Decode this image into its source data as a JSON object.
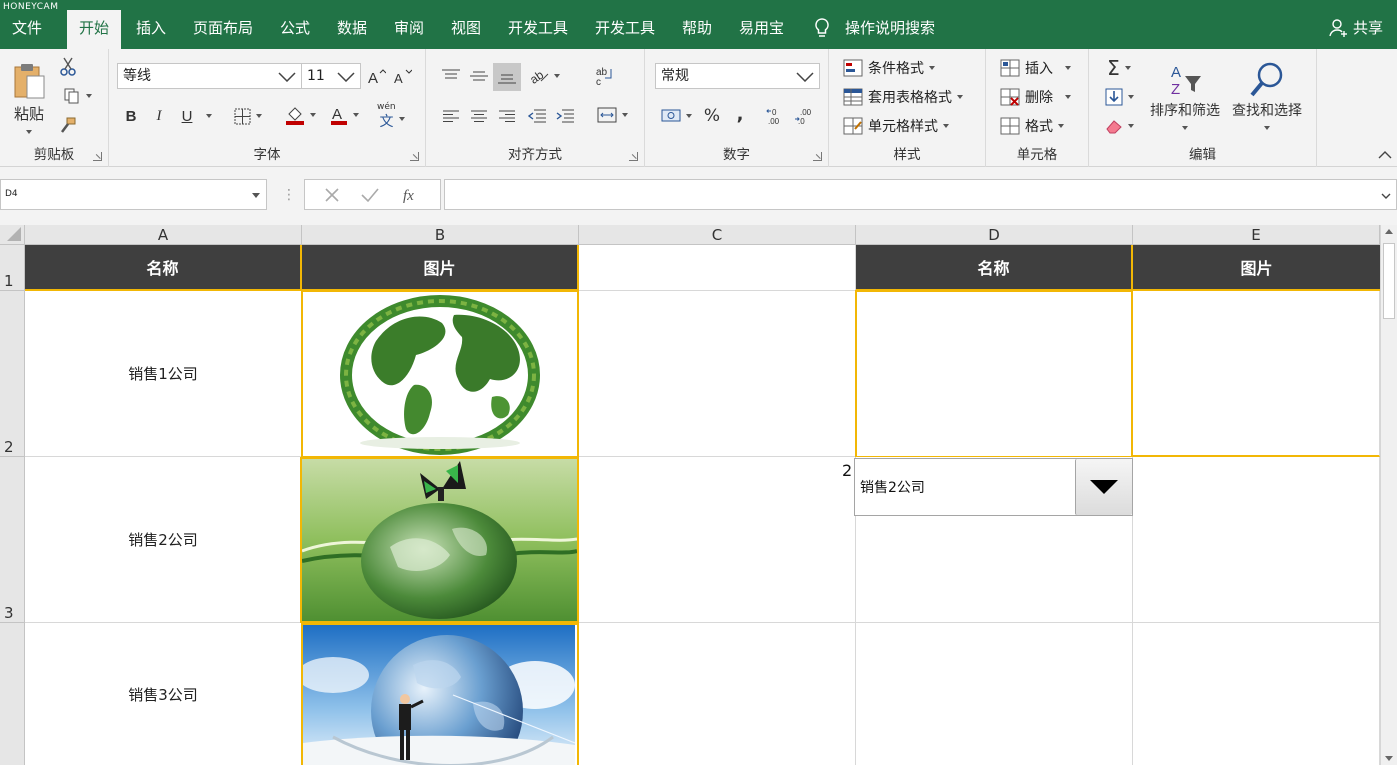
{
  "watermark": "HONEYCAM",
  "tabs": [
    {
      "label": "文件",
      "active": false
    },
    {
      "label": "开始",
      "active": true
    },
    {
      "label": "插入",
      "active": false
    },
    {
      "label": "页面布局",
      "active": false
    },
    {
      "label": "公式",
      "active": false
    },
    {
      "label": "数据",
      "active": false
    },
    {
      "label": "审阅",
      "active": false
    },
    {
      "label": "视图",
      "active": false
    },
    {
      "label": "开发工具",
      "active": false
    },
    {
      "label": "开发工具",
      "active": false
    },
    {
      "label": "帮助",
      "active": false
    },
    {
      "label": "易用宝",
      "active": false
    }
  ],
  "tell_me": "操作说明搜索",
  "share": "共享",
  "ribbon": {
    "clipboard": {
      "label": "剪贴板",
      "paste": "粘贴"
    },
    "font": {
      "label": "字体",
      "font_name": "等线",
      "font_size": "11",
      "bold": "B",
      "italic": "I",
      "underline": "U",
      "pinyin": "wén"
    },
    "alignment": {
      "label": "对齐方式"
    },
    "number": {
      "label": "数字",
      "format": "常规",
      "percent": "%",
      "comma": ","
    },
    "styles": {
      "label": "样式",
      "conditional": "条件格式",
      "table": "套用表格格式",
      "cell_styles": "单元格样式"
    },
    "cells": {
      "label": "单元格",
      "insert": "插入",
      "delete": "删除",
      "format": "格式"
    },
    "editing": {
      "label": "编辑",
      "sort_filter": "排序和筛选",
      "find_select": "查找和选择"
    }
  },
  "formula_bar": {
    "name_box": "D4",
    "formula": ""
  },
  "columns": [
    "A",
    "B",
    "C",
    "D",
    "E"
  ],
  "rows": [
    "1",
    "2",
    "3"
  ],
  "sheet": {
    "headers": {
      "a1": "名称",
      "b1": "图片",
      "d1": "名称",
      "e1": "图片"
    },
    "names": [
      "销售1公司",
      "销售2公司",
      "销售3公司"
    ]
  },
  "dropdown": {
    "value": "销售2公司",
    "side_number": "2"
  },
  "colors": {
    "excel_green": "#217346",
    "header_dark": "#3f3f3f",
    "accent_yellow": "#f2b705"
  }
}
